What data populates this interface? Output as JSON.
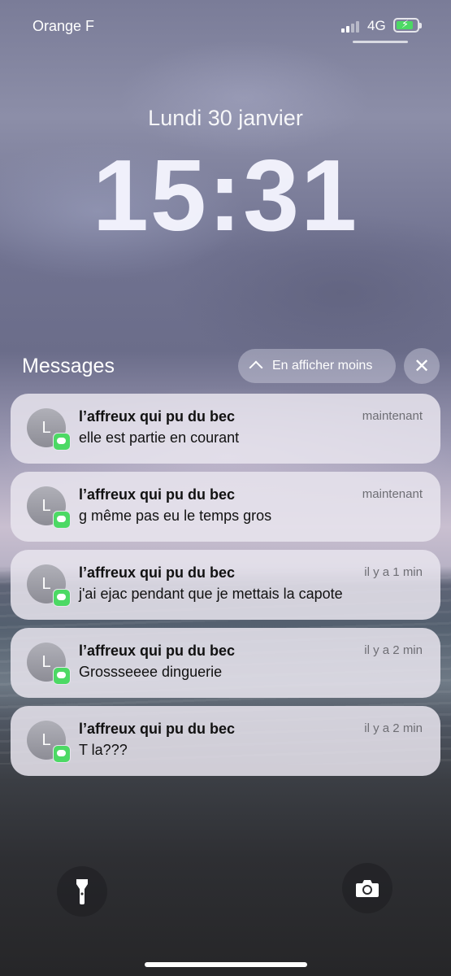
{
  "status_bar": {
    "carrier": "Orange F",
    "network": "4G",
    "signal_bars_active": 2,
    "battery_charging": true,
    "battery_color": "#4cd964"
  },
  "lock_screen": {
    "date": "Lundi 30 janvier",
    "time": "15:31"
  },
  "group": {
    "title": "Messages",
    "show_less_label": "En afficher moins",
    "clear_icon": "close-icon"
  },
  "notifications": [
    {
      "avatar_initial": "L",
      "sender": "l’affreux qui pu du bec",
      "time": "maintenant",
      "body": "elle est partie en courant"
    },
    {
      "avatar_initial": "L",
      "sender": "l’affreux qui pu du bec",
      "time": "maintenant",
      "body": "g même pas eu le temps gros"
    },
    {
      "avatar_initial": "L",
      "sender": "l’affreux qui pu du bec",
      "time": "il y a 1 min",
      "body": "j'ai ejac pendant que je mettais la capote"
    },
    {
      "avatar_initial": "L",
      "sender": "l’affreux qui pu du bec",
      "time": "il y a 2 min",
      "body": "Grossseeee dinguerie"
    },
    {
      "avatar_initial": "L",
      "sender": "l’affreux qui pu du bec",
      "time": "il y a 2 min",
      "body": "T la???"
    }
  ],
  "controls": {
    "left_icon": "flashlight-icon",
    "right_icon": "camera-icon"
  }
}
